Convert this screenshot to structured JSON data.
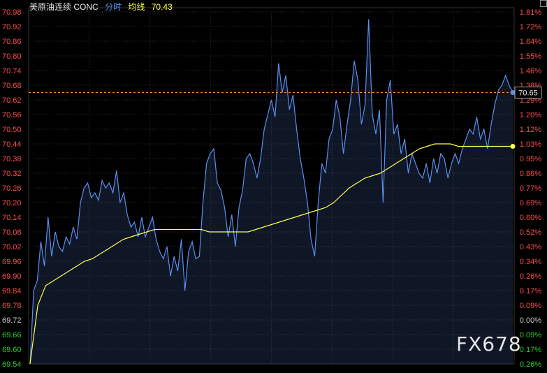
{
  "header": {
    "instrument": "美原油连续 CONC",
    "mode": "分时",
    "avg_label": "均线",
    "avg_value": "70.43"
  },
  "watermark": "FX678",
  "colors": {
    "background": "#000000",
    "price_line": "#5b8ff0",
    "avg_line": "#ffff4d",
    "up_text": "#ff4d4d",
    "down_text": "#33cc33",
    "neutral_text": "#cccccc",
    "grid": "#2a2a2a",
    "ref_line": "#ff9933"
  },
  "chart_data": {
    "type": "line",
    "title": "",
    "xlabel": "",
    "ylabel": "",
    "ylim": [
      69.54,
      70.98
    ],
    "y_ticks": [
      "70.98",
      "70.92",
      "70.86",
      "70.80",
      "70.74",
      "70.68",
      "70.62",
      "70.56",
      "70.50",
      "70.44",
      "70.38",
      "70.32",
      "70.26",
      "70.20",
      "70.14",
      "70.08",
      "70.02",
      "69.96",
      "69.90",
      "69.84",
      "69.78",
      "69.72",
      "69.66",
      "69.60",
      "69.54"
    ],
    "pct_ticks": [
      "1.81%",
      "1.72%",
      "1.64%",
      "1.55%",
      "1.46%",
      "1.38%",
      "1.29%",
      "1.20%",
      "1.12%",
      "1.03%",
      "0.95%",
      "0.86%",
      "0.77%",
      "0.69%",
      "0.60%",
      "0.52%",
      "0.43%",
      "0.34%",
      "0.26%",
      "0.17%",
      "0.09%",
      "0.00%",
      "0.09%",
      "0.17%",
      "0.26%"
    ],
    "reference_price": 69.72,
    "last_price": 70.65,
    "last_price_label": "70.65",
    "avg_last": 70.43,
    "grid": true,
    "series": [
      {
        "name": "分时",
        "values": [
          69.54,
          69.84,
          69.88,
          70.04,
          69.94,
          70.14,
          69.98,
          70.08,
          70.02,
          70.0,
          70.06,
          70.03,
          70.1,
          70.05,
          70.2,
          70.26,
          70.28,
          70.22,
          70.24,
          70.21,
          70.29,
          70.26,
          70.28,
          70.24,
          70.33,
          70.2,
          70.24,
          70.15,
          70.1,
          70.12,
          70.06,
          70.14,
          70.06,
          70.1,
          70.14,
          70.05,
          70.0,
          69.97,
          70.02,
          69.9,
          69.98,
          69.92,
          70.05,
          69.84,
          70.0,
          70.04,
          69.97,
          69.98,
          70.2,
          70.36,
          70.4,
          70.42,
          70.28,
          70.25,
          70.18,
          70.06,
          70.15,
          70.02,
          70.18,
          70.25,
          70.38,
          70.4,
          70.36,
          70.3,
          70.38,
          70.5,
          70.56,
          70.62,
          70.55,
          70.77,
          70.65,
          70.72,
          70.58,
          70.64,
          70.5,
          70.38,
          70.3,
          70.2,
          70.05,
          69.98,
          70.2,
          70.36,
          70.32,
          70.46,
          70.5,
          70.62,
          70.55,
          70.4,
          70.52,
          70.62,
          70.78,
          70.7,
          70.52,
          70.6,
          70.95,
          70.56,
          70.48,
          70.58,
          70.2,
          70.62,
          70.7,
          70.48,
          70.52,
          70.4,
          70.46,
          70.32,
          70.4,
          70.36,
          70.32,
          70.3,
          70.36,
          70.28,
          70.38,
          70.32,
          70.4,
          70.38,
          70.3,
          70.36,
          70.4,
          70.36,
          70.42,
          70.46,
          70.5,
          70.48,
          70.55,
          70.46,
          70.5,
          70.42,
          70.52,
          70.6,
          70.66,
          70.68,
          70.72,
          70.68,
          70.65
        ]
      },
      {
        "name": "均线",
        "values": [
          69.54,
          69.78,
          69.86,
          69.88,
          69.9,
          69.92,
          69.94,
          69.96,
          69.97,
          69.99,
          70.01,
          70.03,
          70.05,
          70.06,
          70.07,
          70.08,
          70.09,
          70.09,
          70.09,
          70.09,
          70.09,
          70.09,
          70.09,
          70.08,
          70.08,
          70.08,
          70.08,
          70.08,
          70.08,
          70.09,
          70.1,
          70.11,
          70.12,
          70.13,
          70.14,
          70.15,
          70.16,
          70.17,
          70.18,
          70.2,
          70.23,
          70.26,
          70.28,
          70.3,
          70.31,
          70.32,
          70.34,
          70.36,
          70.38,
          70.4,
          70.42,
          70.43,
          70.44,
          70.44,
          70.44,
          70.43,
          70.43,
          70.43,
          70.43,
          70.43,
          70.43,
          70.43,
          70.43
        ]
      }
    ]
  }
}
